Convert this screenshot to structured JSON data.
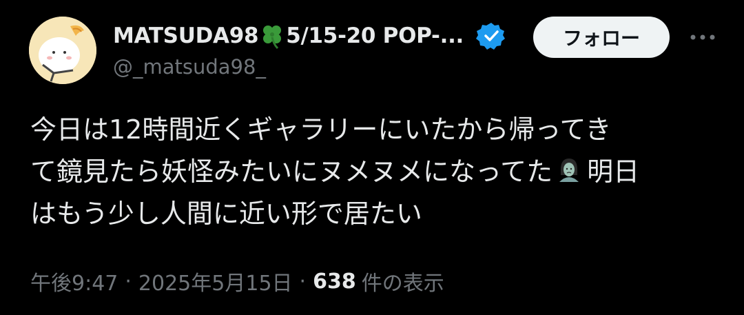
{
  "author": {
    "display_name_prefix": "MATSUDA98",
    "display_name_suffix": "5/15-20 POP-...",
    "handle": "@_matsuda98_",
    "avatar_icon": "avatar-icon",
    "clover_icon": "four-leaf-clover-icon",
    "verified_icon": "verified-badge-icon"
  },
  "actions": {
    "follow_label": "フォロー",
    "more_icon": "more-options-icon"
  },
  "tweet": {
    "text_lines": [
      "今日は12時間近くギャラリーにいたから帰ってき",
      "て鏡見たら妖怪みたいにヌメヌメになってた",
      "はもう少し人間に近い形で居たい"
    ],
    "line2_after_emoji": "明日",
    "emoji_icon": "zombie-woman-emoji"
  },
  "meta": {
    "time": "午後9:47",
    "separator": "·",
    "date": "2025年5月15日",
    "views_count": "638",
    "views_label": "件の表示"
  },
  "colors": {
    "background": "#000000",
    "text_primary": "#e7e9ea",
    "text_secondary": "#71767b",
    "follow_bg": "#eff3f4",
    "follow_text": "#0f1419",
    "verified": "#1d9bf0",
    "clover": "#3a9a3a"
  }
}
